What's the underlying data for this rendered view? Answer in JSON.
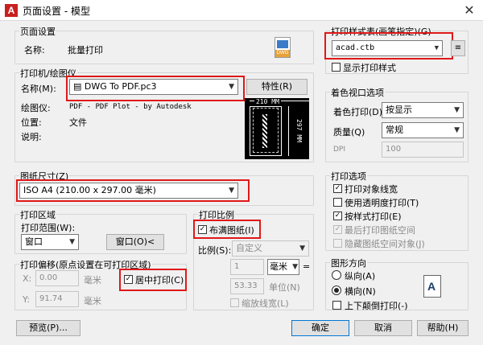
{
  "window": {
    "title": "页面设置 - 模型",
    "app_icon": "A"
  },
  "page_setup": {
    "group": "页面设置",
    "name_label": "名称:",
    "name_value": "批量打印",
    "badge": "DWG"
  },
  "plotter": {
    "group": "打印机/绘图仪",
    "name_label": "名称(M):",
    "name_value": "DWG To PDF.pc3",
    "properties_button": "特性(R)",
    "plotter_label": "绘图仪:",
    "plotter_value": "PDF - PDF Plot - by Autodesk",
    "location_label": "位置:",
    "location_value": "文件",
    "desc_label": "说明:",
    "preview_width": "210 MM",
    "preview_height": "297 MM"
  },
  "paper_size": {
    "group": "图纸尺寸(Z)",
    "value": "ISO A4 (210.00 x 297.00 毫米)"
  },
  "plot_area": {
    "group": "打印区域",
    "range_label": "打印范围(W):",
    "range_value": "窗口",
    "window_button": "窗口(O)<"
  },
  "plot_offset": {
    "group": "打印偏移(原点设置在可打印区域)",
    "x_label": "X:",
    "x_value": "0.00",
    "x_unit": "毫米",
    "y_label": "Y:",
    "y_value": "91.74",
    "y_unit": "毫米",
    "center_label": "居中打印(C)"
  },
  "plot_scale": {
    "group": "打印比例",
    "fit_label": "布满图纸(I)",
    "scale_label": "比例(S):",
    "scale_value": "自定义",
    "num_value": "1",
    "unit_value": "毫米",
    "eq": "=",
    "units_value": "53.33",
    "units_label": "单位(N)",
    "lineweight_label": "缩放线宽(L)"
  },
  "plot_style": {
    "group": "打印样式表(画笔指定)(G)",
    "value": "acad.ctb",
    "show_label": "显示打印样式",
    "edit_icon": "≡"
  },
  "shaded": {
    "group": "着色视口选项",
    "shade_label": "着色打印(D)",
    "shade_value": "按显示",
    "quality_label": "质量(Q)",
    "quality_value": "常规",
    "dpi_label": "DPI",
    "dpi_value": "100"
  },
  "plot_options": {
    "group": "打印选项",
    "items": [
      {
        "label": "打印对象线宽",
        "checked": true,
        "enabled": true
      },
      {
        "label": "使用透明度打印(T)",
        "checked": false,
        "enabled": true
      },
      {
        "label": "按样式打印(E)",
        "checked": true,
        "enabled": true
      },
      {
        "label": "最后打印图纸空间",
        "checked": true,
        "enabled": false
      },
      {
        "label": "隐藏图纸空间对象(J)",
        "checked": false,
        "enabled": false
      }
    ]
  },
  "orientation": {
    "group": "图形方向",
    "portrait": "纵向(A)",
    "landscape": "横向(N)",
    "upside": "上下颠倒打印(-)",
    "selected": "landscape",
    "icon_letter": "A"
  },
  "footer": {
    "preview": "预览(P)...",
    "ok": "确定",
    "cancel": "取消",
    "help": "帮助(H)"
  },
  "accent": {
    "highlight": "#e01818",
    "focus": "#0078d7"
  }
}
